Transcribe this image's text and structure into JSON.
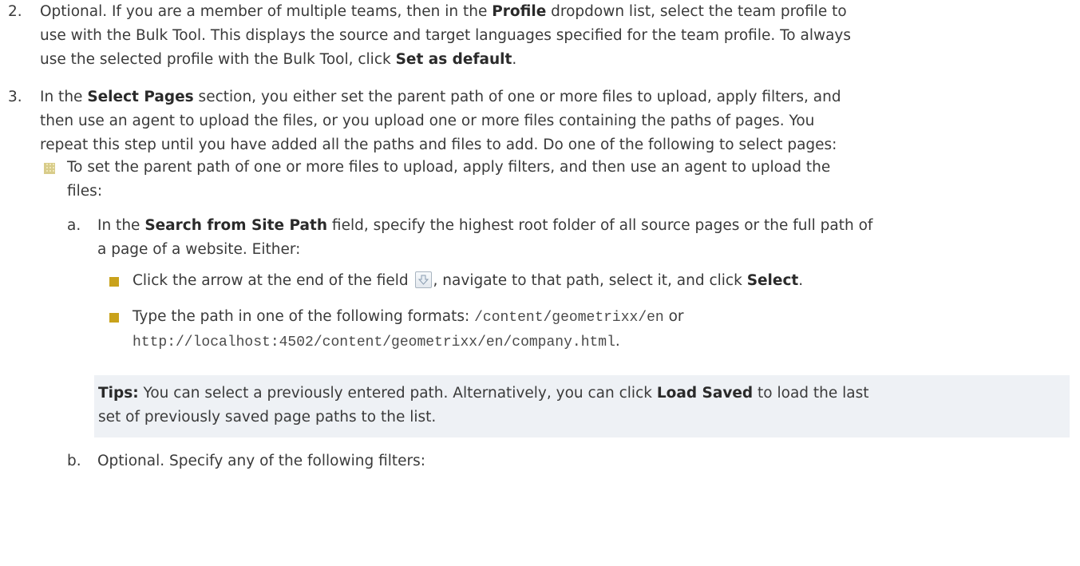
{
  "steps": {
    "s2": {
      "number": "2.",
      "l1a": "Optional. If you are a member of multiple teams, then in the ",
      "l1b": "Profile",
      "l1c": " dropdown list, select the team profile to",
      "l2": "use with the Bulk Tool. This displays the source and target languages specified for the team profile. To always",
      "l3a": "use the selected profile with the Bulk Tool, click ",
      "l3b": "Set as default",
      "l3c": "."
    },
    "s3": {
      "number": "3.",
      "l1a": "In the ",
      "l1b": "Select Pages",
      "l1c": " section, you either set the parent path of one or more files to upload, apply filters, and",
      "l2": "then use an agent to upload the files, or you upload one or more files containing the paths of pages. You",
      "l3": "repeat this step until you have added all the paths and files to add. Do one of the following to select pages:"
    }
  },
  "bullet1": {
    "l1": "To set the parent path of one or more files to upload, apply filters, and then use an agent to upload the",
    "l2": "files:"
  },
  "sub_a": {
    "letter": "a.",
    "l1a": "In the ",
    "l1b": "Search from Site Path",
    "l1c": " field, specify the highest root folder of all source pages or the full path of",
    "l2": "a page of a website. Either:"
  },
  "sub_bullets": {
    "b1a": "Click the arrow at the end of the field ",
    "b1b": ", navigate to that path, select it, and click ",
    "b1c": "Select",
    "b1d": ".",
    "b2a": "Type the path in one of the following formats: ",
    "b2b": "/content/geometrixx/en",
    "b2c": " or",
    "b2d": "http://localhost:4502/content/geometrixx/en/company.html",
    "b2e": "."
  },
  "tips": {
    "label": "Tips:",
    "l1a": " You can select a previously entered path. Alternatively, you can click ",
    "l1b": "Load Saved",
    "l1c": " to load the last",
    "l2": "set of previously saved page paths to the list."
  },
  "sub_b": {
    "letter": "b.",
    "l1": "Optional. Specify any of the following filters:"
  },
  "icons": {
    "grid_bullet": "grid-square-bullet-icon",
    "square_bullet": "gold-square-bullet-icon",
    "arrow": "down-arrow-button-icon"
  },
  "colors": {
    "square_bullet": "#c9a21b",
    "tips_background": "#eef1f5"
  }
}
